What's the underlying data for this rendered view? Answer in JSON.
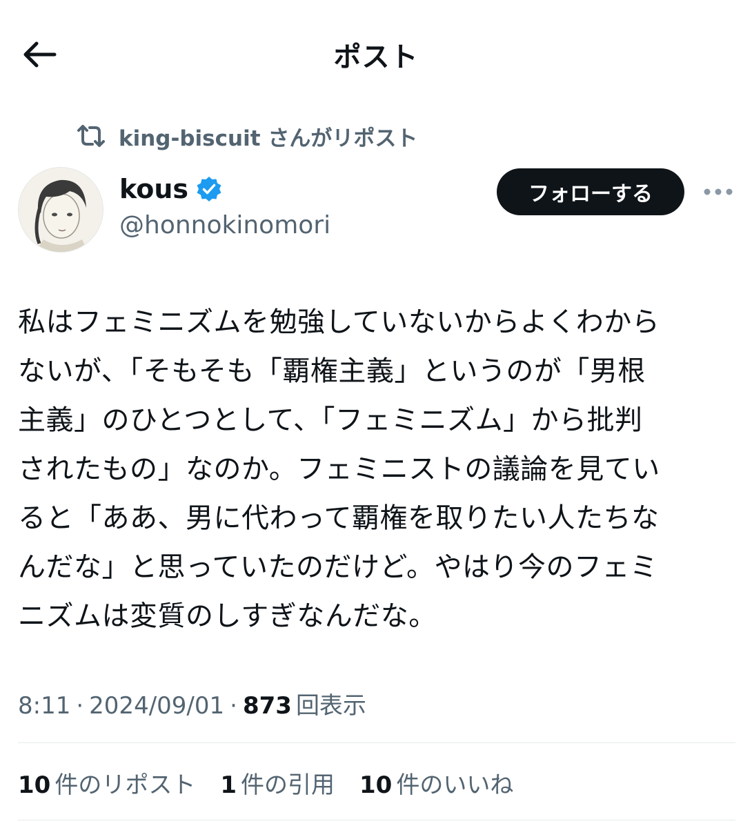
{
  "header": {
    "title": "ポスト",
    "back_icon": "arrow-left-icon"
  },
  "repost": {
    "icon": "repost-icon",
    "text": "king-biscuit さんがリポスト"
  },
  "author": {
    "display_name": "kous",
    "handle": "@honnokinomori",
    "verified": true,
    "verified_color": "#1d9bf0"
  },
  "actions": {
    "follow_label": "フォローする",
    "more_icon": "more-horizontal-icon"
  },
  "post": {
    "text": "私はフェミニズムを勉強していないからよくわから\nないが、「そもそも「覇権主義」というのが「男根\n主義」のひとつとして、「フェミニズム」から批判\nされたもの」なのか。フェミニストの議論を見てい\nると「ああ、男に代わって覇権を取りたい人たちな\nんだな」と思っていたのだけど。やはり今のフェミ\nニズムは変質のしすぎなんだな。"
  },
  "meta": {
    "time": "8:11",
    "separator": "·",
    "date": "2024/09/01",
    "views_count": "873",
    "views_label": "回表示"
  },
  "stats": {
    "reposts_count": "10",
    "reposts_label": "件のリポスト",
    "quotes_count": "1",
    "quotes_label": "件の引用",
    "likes_count": "10",
    "likes_label": "件のいいね"
  },
  "colors": {
    "text_primary": "#0f1419",
    "text_secondary": "#536471",
    "divider": "#e6e9ea",
    "follow_bg": "#0f1419"
  }
}
